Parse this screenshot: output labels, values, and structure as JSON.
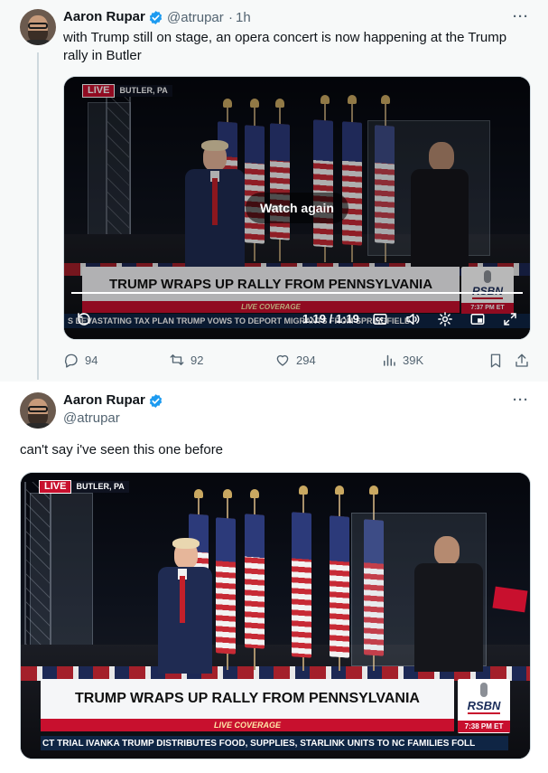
{
  "parent_tweet": {
    "author_name": "Aaron Rupar",
    "handle": "@atrupar",
    "separator": "·",
    "time": "1h",
    "more": "···",
    "text": "with Trump still on stage, an opera concert is now happening at the Trump rally in Butler",
    "video": {
      "live_label": "LIVE",
      "location": "BUTLER, PA",
      "headline": "TRUMP WRAPS UP RALLY FROM PENNSYLVANIA",
      "live_coverage": "LIVE COVERAGE",
      "ticker": "S DEVASTATING TAX PLAN     TRUMP VOWS TO DEPORT MIGRANTS FROM SPRINGFIELD",
      "network": "RSBN",
      "clock": "7:37 PM ET",
      "overlay_button": "Watch again",
      "time_readout": "1:19 / 1:19",
      "progress_fraction": 1.0
    },
    "actions": {
      "replies": "94",
      "reposts": "92",
      "likes": "294",
      "views": "39K"
    }
  },
  "reply_tweet": {
    "author_name": "Aaron Rupar",
    "handle": "@atrupar",
    "more": "···",
    "text": "can't say i've seen this one before",
    "video": {
      "live_label": "LIVE",
      "location": "BUTLER, PA",
      "headline": "TRUMP WRAPS UP RALLY FROM PENNSYLVANIA",
      "live_coverage": "LIVE COVERAGE",
      "ticker": "CT TRIAL     IVANKA TRUMP DISTRIBUTES FOOD, SUPPLIES, STARLINK UNITS TO NC FAMILIES FOLL",
      "network": "RSBN",
      "clock": "7:38 PM ET"
    }
  },
  "colors": {
    "verified_blue": "#1d9bf0",
    "live_red": "#c8102e",
    "ticker_navy": "#0f2544",
    "muted_text": "#536471"
  }
}
